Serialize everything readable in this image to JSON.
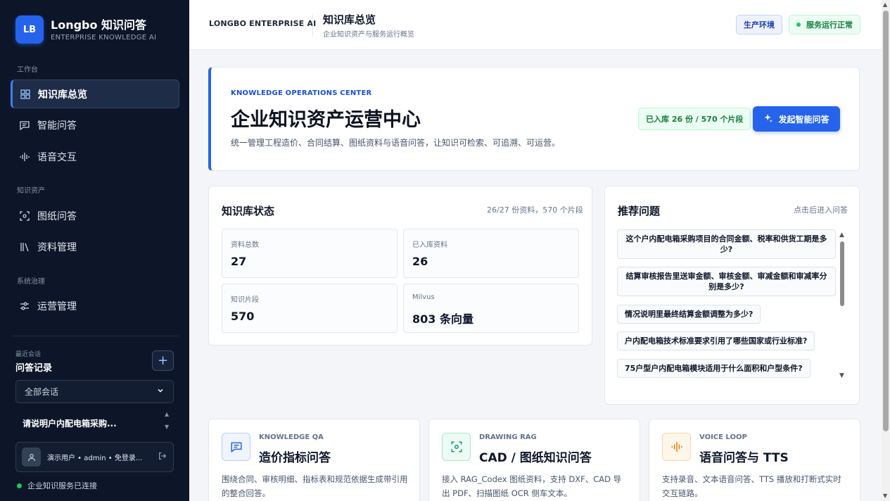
{
  "sidebar": {
    "brand": {
      "logo": "LB",
      "title": "Longbo 知识问答",
      "subtitle": "ENTERPRISE KNOWLEDGE AI"
    },
    "sections": {
      "workbench": "工作台",
      "assets": "知识资产",
      "governance": "系统治理"
    },
    "nav": {
      "overview": "知识库总览",
      "qa": "智能问答",
      "voice": "语音交互",
      "drawing": "图纸问答",
      "docs": "资料管理",
      "ops": "运营管理"
    },
    "recent": {
      "small": "最近会话",
      "title": "问答记录",
      "add": "+",
      "filter": "全部会话",
      "item": "请说明户内配电箱采购..."
    },
    "user": {
      "avatar": "👤",
      "text": "演示用户 • admin • 免登录..."
    },
    "connection": "企业知识服务已连接"
  },
  "header": {
    "brand": "LONGBO ENTERPRISE AI",
    "title": "知识库总览",
    "subtitle": "企业知识资产与服务运行概览",
    "env": "生产环境",
    "status": "服务运行正常"
  },
  "hero": {
    "kicker": "KNOWLEDGE OPERATIONS CENTER",
    "title": "企业知识资产运营中心",
    "desc": "统一管理工程造价、合同结算、图纸资料与语音问答，让知识可检索、可追溯、可运营。",
    "badge": "已入库 26 份 / 570 个片段",
    "button": "发起智能问答"
  },
  "kb_status": {
    "title": "知识库状态",
    "meta": "26/27 份资料，570 个片段",
    "stats": [
      {
        "label": "资料总数",
        "value": "27"
      },
      {
        "label": "已入库资料",
        "value": "26"
      },
      {
        "label": "知识片段",
        "value": "570"
      },
      {
        "label": "Milvus",
        "value": "803 条向量"
      }
    ]
  },
  "recommend": {
    "title": "推荐问题",
    "hint": "点击后进入问答",
    "items": [
      "这个户内配电箱采购项目的合同金额、税率和供货工期是多少?",
      "结算审核报告里送审金额、审核金额、审减金额和审减率分别是多少?",
      "情况说明里最终结算金额调整为多少?",
      "户内配电箱技术标准要求引用了哪些国家或行业标准?",
      "75户型户内配电箱模块适用于什么面积和户型条件?"
    ]
  },
  "features": [
    {
      "kicker": "KNOWLEDGE QA",
      "title": "造价指标问答",
      "desc": "围绕合同、审核明细、指标表和规范依据生成带引用的整合回答。",
      "icon": "chat-icon",
      "color": "#2563eb",
      "bg": "#eff4ff"
    },
    {
      "kicker": "DRAWING RAG",
      "title": "CAD / 图纸知识问答",
      "desc": "接入 RAG_Codex 图纸资料，支持 DXF、CAD 导出 PDF、扫描图纸 OCR 侧车文本。",
      "icon": "scan-icon",
      "color": "#0f9a6e",
      "bg": "#ecfbf4"
    },
    {
      "kicker": "VOICE LOOP",
      "title": "语音问答与 TTS",
      "desc": "支持录音、文本语音问答、TTS 播放和打断式实时交互链路。",
      "icon": "waveform-icon",
      "color": "#ea7a0c",
      "bg": "#fff6ea"
    }
  ]
}
